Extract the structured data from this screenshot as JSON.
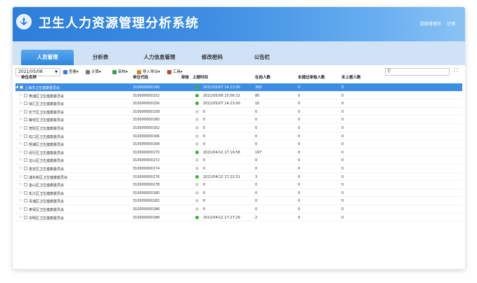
{
  "app": {
    "title": "卫生人力资源管理分析系统",
    "user": "超级管理员",
    "logout": "注销"
  },
  "colors": {
    "header_from": "#2d7ed9",
    "header_to": "#8cc3f4",
    "nav_bg": "#cfe2f6",
    "active_tab": "#3c8de6",
    "status_ok": "#2fb52f",
    "status_none": "#cfcfcf"
  },
  "nav": {
    "tabs": [
      "人员管理",
      "分析表",
      "人力信息管理",
      "修改密码",
      "公告栏"
    ],
    "active": 0
  },
  "toolbar": {
    "date": "2021/05/08",
    "buttons": [
      {
        "label": "查看▾",
        "icon": "view-icon"
      },
      {
        "label": "计算▾",
        "icon": "calculate-icon"
      },
      {
        "label": "审核▾",
        "icon": "audit-icon"
      },
      {
        "label": "导入导出▾",
        "icon": "import-export-icon"
      },
      {
        "label": "工具▾",
        "icon": "tools-icon"
      }
    ],
    "search_placeholder": ""
  },
  "table": {
    "headers": [
      "单位名称",
      "单位代码",
      "审核",
      "上报时间",
      "在岗人数",
      "未通过审核人数",
      "未上报人数"
    ],
    "rows": [
      {
        "name": "上海市卫生健康委员会",
        "code": "310000000146",
        "status": "ok",
        "time": "2021/05/07 14:23:00",
        "onduty": "300",
        "failed": "0",
        "unreported": "0",
        "selected": true,
        "root": true
      },
      {
        "name": "黄浦区卫生健康委员会",
        "code": "310000000152",
        "status": "ok",
        "time": "2021/05/06 15:00:12",
        "onduty": "80",
        "failed": "0",
        "unreported": "0"
      },
      {
        "name": "徐汇区卫生健康委员会",
        "code": "310000000156",
        "status": "ok",
        "time": "2021/05/07 14:23:00",
        "onduty": "10",
        "failed": "0",
        "unreported": "0"
      },
      {
        "name": "长宁区卫生健康委员会",
        "code": "310000000158",
        "status": "none",
        "time": "0",
        "onduty": "0",
        "failed": "0",
        "unreported": "0"
      },
      {
        "name": "静安区卫生健康委员会",
        "code": "310000000160",
        "status": "none",
        "time": "0",
        "onduty": "0",
        "failed": "0",
        "unreported": "0"
      },
      {
        "name": "普陀区卫生健康委员会",
        "code": "310000000162",
        "status": "none",
        "time": "0",
        "onduty": "0",
        "failed": "0",
        "unreported": "0"
      },
      {
        "name": "虹口区卫生健康委员会",
        "code": "310000000166",
        "status": "none",
        "time": "0",
        "onduty": "0",
        "failed": "0",
        "unreported": "0"
      },
      {
        "name": "杨浦区卫生健康委员会",
        "code": "310000000168",
        "status": "none",
        "time": "0",
        "onduty": "0",
        "failed": "0",
        "unreported": "0"
      },
      {
        "name": "闵行区卫生健康委员会",
        "code": "310000000170",
        "status": "ok",
        "time": "2021/04/12 17:19:58",
        "onduty": "197",
        "failed": "0",
        "unreported": "0"
      },
      {
        "name": "宝山区卫生健康委员会",
        "code": "310000000172",
        "status": "none",
        "time": "0",
        "onduty": "0",
        "failed": "0",
        "unreported": "0"
      },
      {
        "name": "嘉定区卫生健康委员会",
        "code": "310000000174",
        "status": "none",
        "time": "0",
        "onduty": "0",
        "failed": "0",
        "unreported": "0"
      },
      {
        "name": "浦东新区卫生健康委员会",
        "code": "310000000176",
        "status": "ok",
        "time": "2021/04/12 17:22:31",
        "onduty": "3",
        "failed": "0",
        "unreported": "0"
      },
      {
        "name": "金山区卫生健康委员会",
        "code": "310000000178",
        "status": "none",
        "time": "0",
        "onduty": "0",
        "failed": "0",
        "unreported": "0"
      },
      {
        "name": "松江区卫生健康委员会",
        "code": "310000000180",
        "status": "none",
        "time": "0",
        "onduty": "0",
        "failed": "0",
        "unreported": "0"
      },
      {
        "name": "青浦区卫生健康委员会",
        "code": "310000000182",
        "status": "none",
        "time": "0",
        "onduty": "0",
        "failed": "0",
        "unreported": "0"
      },
      {
        "name": "奉贤区卫生健康委员会",
        "code": "310000000186",
        "status": "none",
        "time": "0",
        "onduty": "0",
        "failed": "0",
        "unreported": "0"
      },
      {
        "name": "崇明区卫生健康委员会",
        "code": "310000000188",
        "status": "ok",
        "time": "2021/04/12 17:27:29",
        "onduty": "2",
        "failed": "0",
        "unreported": "0"
      }
    ]
  }
}
